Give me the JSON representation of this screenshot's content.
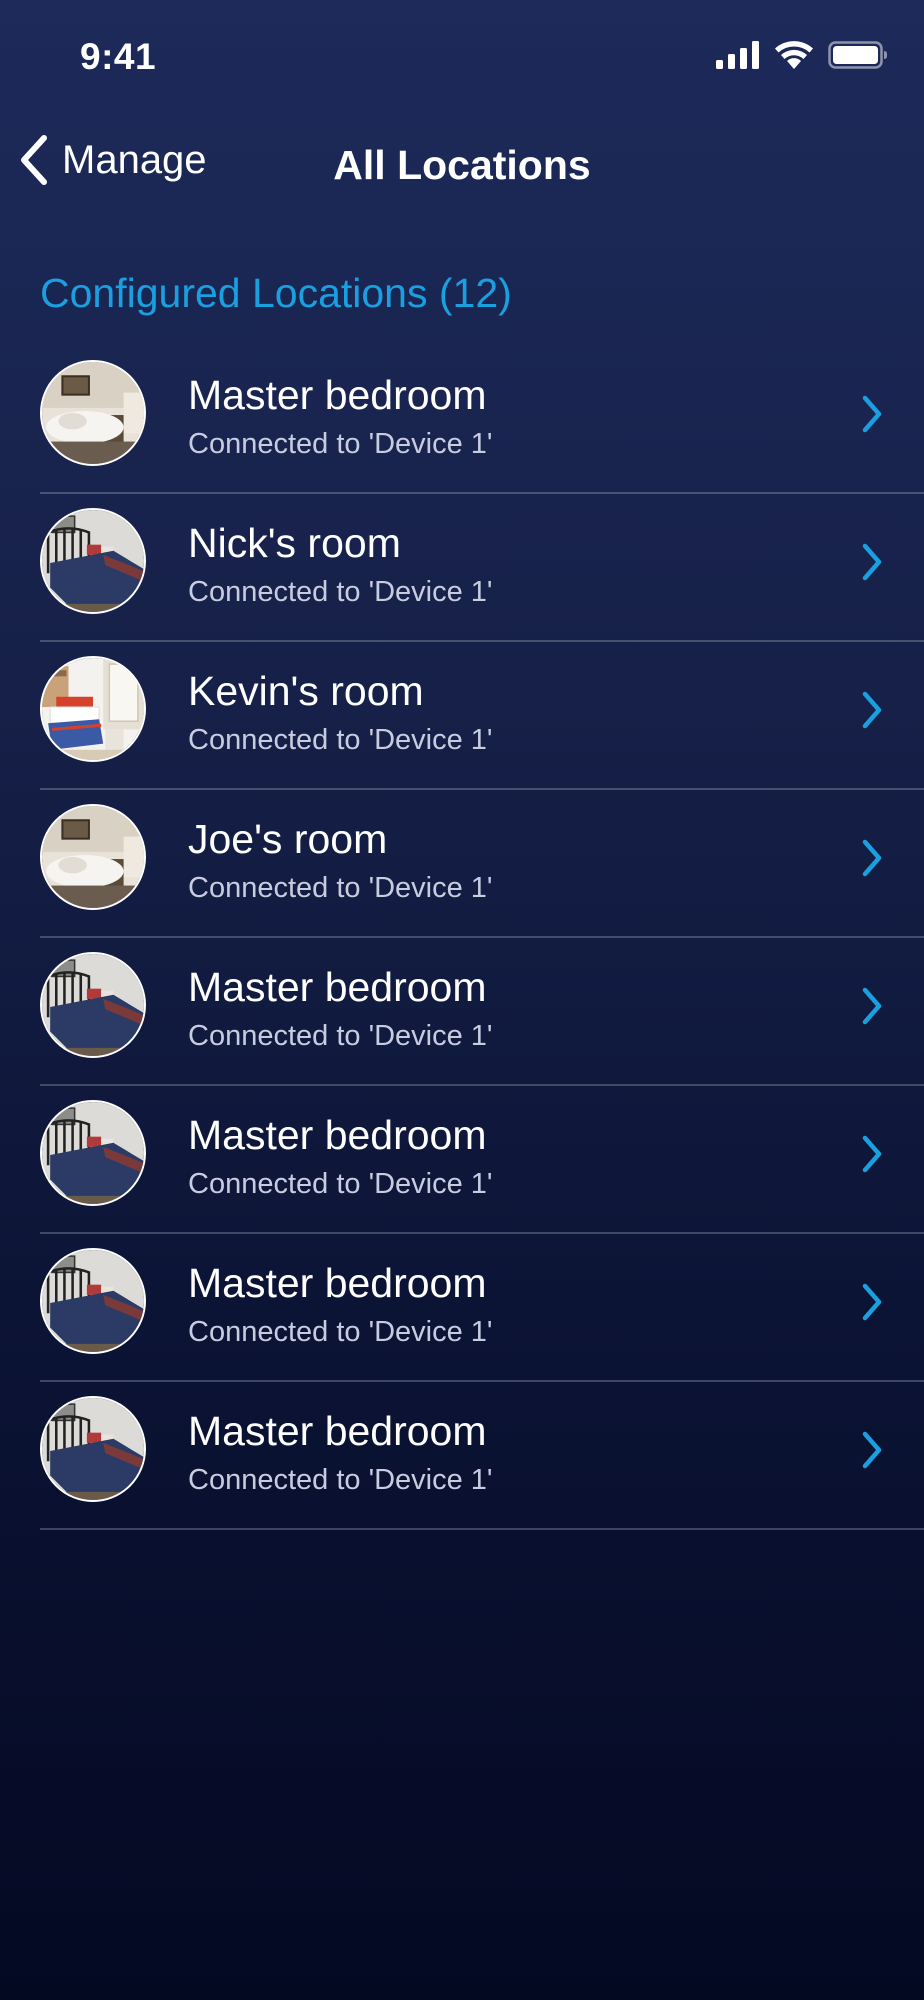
{
  "status_bar": {
    "time": "9:41",
    "icons": [
      "cellular-signal-icon",
      "wifi-icon",
      "battery-icon"
    ]
  },
  "nav": {
    "back_label": "Manage",
    "back_icon": "chevron-left-icon",
    "title": "All Locations"
  },
  "section": {
    "header": "Configured Locations (12)"
  },
  "colors": {
    "accent": "#1a9fe0",
    "background_top": "#1d2a5a",
    "background_bottom": "#040922",
    "subtitle": "#c8cce0"
  },
  "locations": [
    {
      "name": "Master bedroom",
      "status": "Connected to 'Device 1'",
      "thumbnail": "bedroom-white-bedding"
    },
    {
      "name": "Nick's room",
      "status": "Connected to 'Device 1'",
      "thumbnail": "bedroom-navy-quilt"
    },
    {
      "name": "Kevin's room",
      "status": "Connected to 'Device 1'",
      "thumbnail": "bedroom-kids-red"
    },
    {
      "name": "Joe's room",
      "status": "Connected to 'Device 1'",
      "thumbnail": "bedroom-white-bedding"
    },
    {
      "name": "Master bedroom",
      "status": "Connected to 'Device 1'",
      "thumbnail": "bedroom-navy-quilt"
    },
    {
      "name": "Master bedroom",
      "status": "Connected to 'Device 1'",
      "thumbnail": "bedroom-navy-quilt"
    },
    {
      "name": "Master bedroom",
      "status": "Connected to 'Device 1'",
      "thumbnail": "bedroom-navy-quilt"
    },
    {
      "name": "Master bedroom",
      "status": "Connected to 'Device 1'",
      "thumbnail": "bedroom-navy-quilt"
    }
  ]
}
